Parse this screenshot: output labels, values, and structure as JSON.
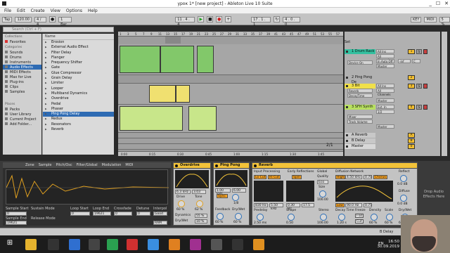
{
  "window": {
    "title": "урок 1* [new project] - Ableton Live 10 Suite",
    "controls": [
      "_",
      "☐",
      "✕"
    ]
  },
  "menu": [
    "File",
    "Edit",
    "Create",
    "View",
    "Options",
    "Help"
  ],
  "transport": {
    "tap": "Tap",
    "tempo": "120.00",
    "sig": "4 / 4",
    "quant": "1 Bar",
    "position": "11 . 4 . 4",
    "loop_start": "17 . 1 . 1",
    "loop_len": "4 . 0 . 0",
    "key": "KEY",
    "midi": "MIDI",
    "cpu": "5 %"
  },
  "browser": {
    "search_placeholder": "Search (Ctrl + F)",
    "collections_header": "Collections",
    "favorites": "Favorites",
    "categories_header": "Categories",
    "categories": [
      "Sounds",
      "Drums",
      "Instruments",
      "Audio Effects",
      "MIDI Effects",
      "Max for Live",
      "Plug-ins",
      "Clips",
      "Samples"
    ],
    "places_header": "Places",
    "places": [
      "Packs",
      "User Library",
      "Current Project",
      "Add Folder..."
    ],
    "name_header": "Name",
    "items": [
      "Erosion",
      "External Audio Effect",
      "Filter Delay",
      "Flanger",
      "Frequency Shifter",
      "Gate",
      "Glue Compressor",
      "Grain Delay",
      "Limiter",
      "Looper",
      "Multiband Dynamics",
      "Overdrive",
      "Pedal",
      "Phaser",
      "Ping Pong Delay",
      "Redux",
      "Resonators",
      "Reverb"
    ]
  },
  "ruler": [
    "1",
    "3",
    "5",
    "7",
    "9",
    "11",
    "13",
    "15",
    "17",
    "19",
    "21",
    "23",
    "25",
    "27",
    "29",
    "31",
    "33",
    "35",
    "37",
    "39",
    "41",
    "43",
    "45",
    "47",
    "49",
    "51",
    "53",
    "55",
    "57"
  ],
  "timeline": [
    "0:00",
    "0:15",
    "0:30",
    "0:45",
    "1:00",
    "1:15",
    "1:30",
    "1:45"
  ],
  "zoom_label": "2/1",
  "set_label": "Set",
  "tracks": [
    {
      "name": "1 Drum Rack",
      "in": "All Ins",
      "ch": "All Channels",
      "mon": "In Auto Off",
      "out": "Master",
      "n": "1",
      "vol": "-inf",
      "pan": "C",
      "device": "Device On",
      "color": "#34c0a0"
    },
    {
      "name": "2 Ping Pong De",
      "in": "All Ins",
      "ch": "All Channels",
      "out": "Master",
      "n": "2"
    },
    {
      "name": "3 Bit",
      "in": "All Ins",
      "ch": "All Channels",
      "out": "Master",
      "n": "3",
      "dev": "Reverb",
      "param": "DecayTime",
      "color": "#f0e04a"
    },
    {
      "name": "3 SFH Synth",
      "in": "Ext. In",
      "ch": "1/2",
      "dev": "Mixer",
      "param": "Track Volume",
      "out": "Master",
      "n": "4",
      "color": "#b8e060"
    },
    {
      "name": "A Reverb",
      "n": "A"
    },
    {
      "name": "B Delay",
      "n": "B"
    },
    {
      "name": "Master",
      "n": "0"
    }
  ],
  "detail": {
    "tabs": [
      "Zone",
      "Sample",
      "Pitch/Osc",
      "Filter/Global",
      "Modulation",
      "MIDI"
    ],
    "sample": {
      "start_label": "Sample Start",
      "start": "0",
      "end_label": "Sample End",
      "end": "19621",
      "sustain_label": "Sustain Mode",
      "release_label": "Release Mode",
      "loop_start_label": "Loop Start",
      "loop_end_label": "Loop End",
      "crossfade_label": "Crossfade",
      "detune_label": "Detune",
      "interp_label": "Interpol",
      "interp": "Good",
      "ram": "RAM",
      "loop_start_val": "0",
      "loop_end_val": "19621",
      "crossfade_val": "0",
      "detune_val": "0"
    },
    "overdrive": {
      "title": "Overdrive",
      "freq": "6.3 kHz",
      "width": "3.03",
      "drive_label": "Drive",
      "drive": "60 %",
      "tone_label": "Tone",
      "tone": "62 %",
      "dynamics_label": "Dynamics",
      "dynamics": "55 %",
      "drywet_label": "Dry/Wet",
      "drywet": "10 %"
    },
    "pingpong": {
      "title": "Ping Pong",
      "sync": "Sync",
      "freq": "1.00 kHz",
      "width": "6.00",
      "time": "1/8",
      "feedback_label": "Feedback",
      "feedback": "60 %",
      "drywet_label": "Dry/Wet",
      "drywet": "60 %",
      "freeze": "F"
    },
    "reverb": {
      "title": "Reverb",
      "input_label": "Input Processing",
      "lo": "Lo Cut",
      "hi": "Hi Cut",
      "early_label": "Early Reflections",
      "spin": "Spin",
      "global_label": "Global",
      "quality_label": "Quality",
      "quality": "Eco",
      "size_label": "Size",
      "size": "100.00",
      "diffusion_label": "Diffusion Network",
      "high": "High",
      "high_val": "4.50 kHz",
      "high_q": "0.70",
      "chorus": "Chorus",
      "low": "Low",
      "low_val": "90.0 Hz",
      "low_q": "0.75",
      "reflect_label": "Reflect",
      "reflect": "0.0 dB",
      "diffuse_label": "Diffuse",
      "diffuse": "0.0 dB",
      "f1": "830 Hz",
      "f2": "5.50 kHz",
      "e1": "0.30 Hz",
      "e2": "17.5",
      "predelay_label": "Predelay",
      "predelay": "2.50 ms",
      "shape_label": "Shape",
      "shape": "0.50",
      "stereo_label": "Stereo",
      "stereo": "100.00",
      "decay_label": "Decay Time",
      "decay": "1.20 s",
      "freeze_label": "Freeze",
      "freeze": "Flat",
      "cut": "Cut",
      "density_label": "Density",
      "density": "60 %",
      "scale_label": "Scale",
      "scale": "60 %",
      "drywet_label": "Dry/Wet",
      "drywet": "60 %"
    },
    "drop": "Drop Audio Effects Here"
  },
  "status": {
    "track": "B Delay"
  },
  "taskbar": {
    "time": "16:50",
    "date": "30.09.2019",
    "lang": "EN"
  },
  "colors": {
    "accent": "#f2c239",
    "selection": "#2e6bb3",
    "play": "#1e9e1e"
  }
}
